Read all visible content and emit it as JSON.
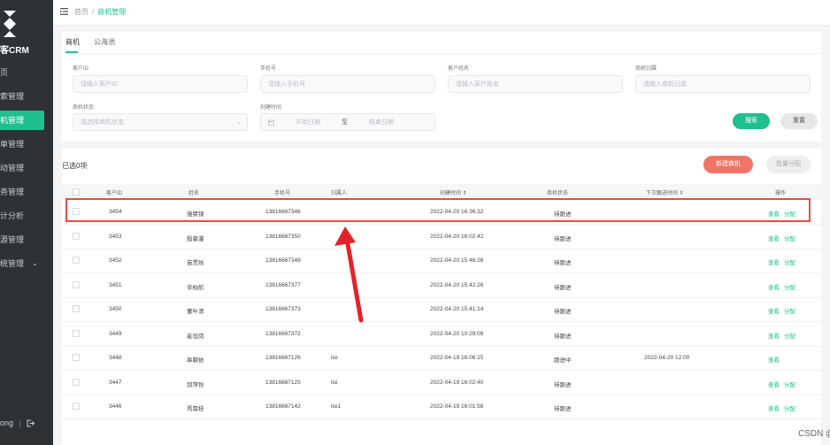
{
  "sidebar": {
    "logo_text": "客CRM",
    "items": [
      {
        "label": "页"
      },
      {
        "label": "索管理"
      },
      {
        "label": "机管理"
      },
      {
        "label": "单管理"
      },
      {
        "label": "动管理"
      },
      {
        "label": "务管理"
      },
      {
        "label": "计分析"
      },
      {
        "label": "源管理"
      },
      {
        "label": "统管理"
      }
    ],
    "footer_user": "ong",
    "footer_sep": "|"
  },
  "breadcrumb": {
    "home": "首页",
    "sep": "/",
    "current": "商机管理"
  },
  "tabs": [
    {
      "label": "商机"
    },
    {
      "label": "公海池"
    }
  ],
  "filters": {
    "customer_id": {
      "label": "客户ID",
      "placeholder": "请输入客户ID"
    },
    "phone": {
      "label": "手机号",
      "placeholder": "请输入手机号"
    },
    "customer_name": {
      "label": "客户姓名",
      "placeholder": "请输入客户姓名"
    },
    "owner": {
      "label": "商机归属",
      "placeholder": "请输入商机归属"
    },
    "status": {
      "label": "商机状态",
      "placeholder": "请选择商机状态"
    },
    "created": {
      "label": "创建时间",
      "start_placeholder": "开始日期",
      "separator": "至",
      "end_placeholder": "结束日期"
    }
  },
  "buttons": {
    "search": "搜索",
    "reset": "重置",
    "new": "新建商机",
    "batch": "批量分配"
  },
  "selected_text": "已选0项",
  "table": {
    "headers": [
      "客户ID",
      "姓名",
      "手机号",
      "归属人",
      "创建时间 ⇕",
      "商机状态 ·",
      "下次跟进时间 ⇕",
      "操作"
    ],
    "rows": [
      {
        "id": "3454",
        "name": "骆譬锦",
        "phone": "13816667346",
        "owner": "",
        "created": "2022-04-20 16:36:32",
        "status": "待跟进",
        "next": "",
        "view": "查看",
        "assign": "分配"
      },
      {
        "id": "3453",
        "name": "殷豪瀑",
        "phone": "13816667350",
        "owner": "",
        "created": "2022-04-20 16:02:42",
        "status": "待跟进",
        "next": "",
        "view": "查看",
        "assign": "分配"
      },
      {
        "id": "3452",
        "name": "苗贯始",
        "phone": "13816667349",
        "owner": "",
        "created": "2022-04-20 15:46:26",
        "status": "待跟进",
        "next": "",
        "view": "查看",
        "assign": "分配"
      },
      {
        "id": "3451",
        "name": "毕柏航",
        "phone": "13816667377",
        "owner": "",
        "created": "2022-04-20 15:42:26",
        "status": "待跟进",
        "next": "",
        "view": "查看",
        "assign": "分配"
      },
      {
        "id": "3450",
        "name": "董叶清",
        "phone": "13816667373",
        "owner": "",
        "created": "2022-04-20 15:41:14",
        "status": "待跟进",
        "next": "",
        "view": "查看",
        "assign": "分配"
      },
      {
        "id": "3449",
        "name": "崔坦岗",
        "phone": "13816667372",
        "owner": "",
        "created": "2022-04-20 10:29:09",
        "status": "待跟进",
        "next": "",
        "view": "查看",
        "assign": "分配"
      },
      {
        "id": "3448",
        "name": "皋朝依",
        "phone": "13816667126",
        "owner": "lisi",
        "created": "2022-04-19 16:06:15",
        "status": "跟进中",
        "next": "2022-04-20 12:00",
        "view": "查看",
        "assign": ""
      },
      {
        "id": "3447",
        "name": "邱萍怡",
        "phone": "13816667125",
        "owner": "lisi",
        "created": "2022-04-19 16:02:40",
        "status": "待跟进",
        "next": "",
        "view": "查看",
        "assign": "分配"
      },
      {
        "id": "3446",
        "name": "焉需枝",
        "phone": "13816667142",
        "owner": "lisi1",
        "created": "2022-04-19 16:01:58",
        "status": "待跟进",
        "next": "",
        "view": "查看",
        "assign": "分配"
      }
    ]
  },
  "watermark": "CSDN @小樊o",
  "colors": {
    "accent": "#1fbf8f",
    "danger": "#ef7667",
    "sidebar": "#2f3235",
    "annotation": "#e94b45"
  }
}
